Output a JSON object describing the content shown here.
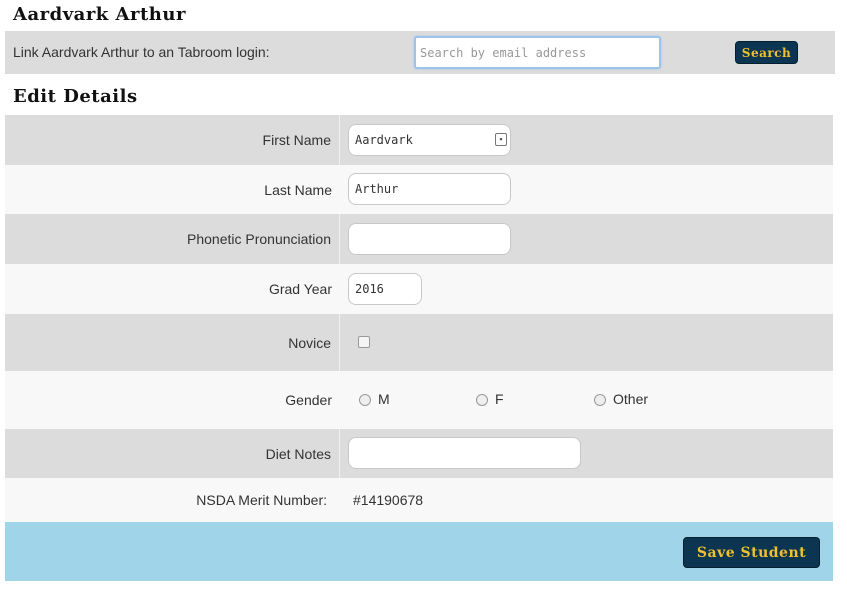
{
  "page": {
    "title": "Aardvark Arthur"
  },
  "link_bar": {
    "label": "Link Aardvark Arthur to an Tabroom login:",
    "email_placeholder": "Search by email address",
    "search_label": "Search"
  },
  "edit": {
    "section_title": "Edit Details",
    "first_name": {
      "label": "First Name",
      "value": "Aardvark"
    },
    "last_name": {
      "label": "Last Name",
      "value": "Arthur"
    },
    "phonetic": {
      "label": "Phonetic Pronunciation",
      "value": ""
    },
    "grad_year": {
      "label": "Grad Year",
      "value": "2016"
    },
    "novice": {
      "label": "Novice",
      "checked": false
    },
    "gender": {
      "label": "Gender",
      "options": [
        "M",
        "F",
        "Other"
      ],
      "selected": ""
    },
    "diet": {
      "label": "Diet Notes",
      "value": ""
    },
    "merit": {
      "label": "NSDA Merit Number:",
      "value": "#14190678"
    }
  },
  "footer": {
    "save_label": "Save Student"
  },
  "colors": {
    "row_dark": "#dcdcdc",
    "row_light": "#f8f8f8",
    "footer_bg": "#a0d4e8",
    "button_bg": "#0b3550",
    "button_text": "#f0c030"
  }
}
